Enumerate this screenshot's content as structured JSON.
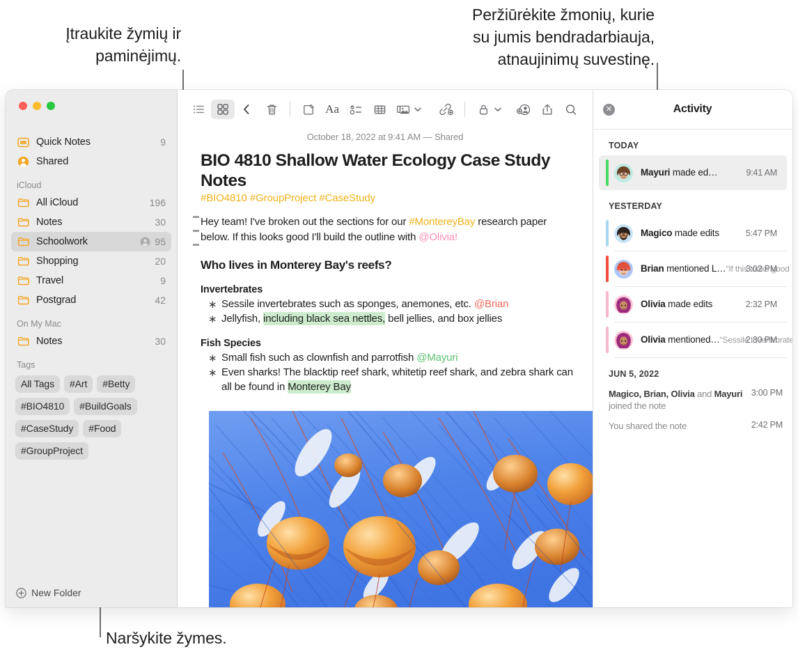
{
  "callouts": {
    "top_left": "Įtraukite žymių ir\npaminėjimų.",
    "top_right": "Peržiūrėkite žmonių, kurie\nsu jumis bendradarbiauja,\natnaujinimų suvestinę.",
    "bottom": "Naršykite žymes."
  },
  "sidebar": {
    "top_items": [
      {
        "label": "Quick Notes",
        "count": "9",
        "icon": "quicknote-icon"
      },
      {
        "label": "Shared",
        "count": "",
        "icon": "shared-person-icon"
      }
    ],
    "sections": [
      {
        "title": "iCloud",
        "items": [
          {
            "label": "All iCloud",
            "count": "196",
            "icon": "folder-icon",
            "selected": false,
            "shared": false
          },
          {
            "label": "Notes",
            "count": "30",
            "icon": "folder-icon",
            "selected": false,
            "shared": false
          },
          {
            "label": "Schoolwork",
            "count": "95",
            "icon": "folder-icon",
            "selected": true,
            "shared": true
          },
          {
            "label": "Shopping",
            "count": "20",
            "icon": "folder-icon",
            "selected": false,
            "shared": false
          },
          {
            "label": "Travel",
            "count": "9",
            "icon": "folder-icon",
            "selected": false,
            "shared": false
          },
          {
            "label": "Postgrad",
            "count": "42",
            "icon": "folder-icon",
            "selected": false,
            "shared": false
          }
        ]
      },
      {
        "title": "On My Mac",
        "items": [
          {
            "label": "Notes",
            "count": "30",
            "icon": "folder-icon",
            "selected": false,
            "shared": false
          }
        ]
      }
    ],
    "tags_title": "Tags",
    "tags": [
      "All Tags",
      "#Art",
      "#Betty",
      "#BIO4810",
      "#BuildGoals",
      "#CaseStudy",
      "#Food",
      "#GroupProject"
    ],
    "new_folder_label": "New Folder"
  },
  "toolbar": {
    "items": [
      {
        "name": "list-view-icon",
        "active": false
      },
      {
        "name": "gallery-view-icon",
        "active": true
      },
      {
        "name": "back-chevron-icon",
        "active": false
      },
      {
        "name": "trash-icon",
        "active": false
      },
      {
        "name": "compose-icon",
        "active": false
      },
      {
        "name": "format-aa-icon",
        "active": false
      },
      {
        "name": "checklist-icon",
        "active": false
      },
      {
        "name": "table-icon",
        "active": false
      },
      {
        "name": "media-icon",
        "active": false
      },
      {
        "name": "link-icon",
        "active": false
      },
      {
        "name": "lock-icon",
        "active": false
      },
      {
        "name": "add-people-icon",
        "active": false
      },
      {
        "name": "share-icon",
        "active": false
      },
      {
        "name": "search-icon",
        "active": false
      }
    ]
  },
  "note": {
    "date": "October 18, 2022 at 9:41 AM — Shared",
    "title": "BIO 4810 Shallow Water Ecology Case Study Notes",
    "tags_line": "#BIO4810 #GroupProject #CaseStudy",
    "intro": {
      "a": "Hey team! I've broken out the sections for our ",
      "tag": "#MontereyBay",
      "b": " research paper below. If this looks good I'll build the outline with ",
      "mention": "@Olivia!"
    },
    "heading": "Who lives in Monterey Bay's reefs?",
    "sections": [
      {
        "subhead": "Invertebrates",
        "bullets": [
          {
            "a": "Sessile invertebrates such as sponges, anemones, etc. ",
            "mention": "@Brian",
            "mention_color": "red",
            "b": ""
          },
          {
            "a": "Jellyfish, ",
            "highlight": "including black sea nettles,",
            "b": " bell jellies, and box jellies"
          }
        ]
      },
      {
        "subhead": "Fish Species",
        "bullets": [
          {
            "a": "Small fish such as clownfish and parrotfish ",
            "mention": "@Mayuri",
            "mention_color": "green",
            "b": ""
          },
          {
            "a": "Even sharks! The blacktip reef shark, whitetip reef shark, and zebra shark can all be found in ",
            "highlight": "Monterey Bay",
            "b": ""
          }
        ]
      }
    ],
    "image_alt": "jellyfish-photo"
  },
  "activity": {
    "title": "Activity",
    "close_label": "✕",
    "groups": [
      {
        "label": "TODAY",
        "entries": [
          {
            "actor": "Mayuri",
            "action": " made ed…",
            "quote": "",
            "time": "9:41 AM",
            "stripe": "#4cd964",
            "highlight": true,
            "avatar_bg": "#bfeae4",
            "hair": "#6d4428",
            "skin": "#e8b898",
            "accessory": "glasses"
          }
        ]
      },
      {
        "label": "YESTERDAY",
        "entries": [
          {
            "actor": "Magico",
            "action": " made edits",
            "quote": "",
            "time": "5:47 PM",
            "stripe": "#a8d8f0",
            "highlight": false,
            "avatar_bg": "#c8e6f7",
            "hair": "#2b2220",
            "skin": "#c98d63",
            "accessory": "glasses"
          },
          {
            "actor": "Brian",
            "action": " mentioned L…",
            "quote": "“If this looks good I'll…",
            "time": "3:02 PM",
            "stripe": "#f0503c",
            "highlight": false,
            "avatar_bg": "#aec6f5",
            "hair": "#b46a4a",
            "skin": "#efc6a8",
            "accessory": "beanie"
          },
          {
            "actor": "Olivia",
            "action": " made edits",
            "quote": "",
            "time": "2:32 PM",
            "stripe": "#f7b8cc",
            "highlight": false,
            "avatar_bg": "#f9c2d8",
            "hair": "#9c2b7a",
            "skin": "#c98d63",
            "accessory": "hijab"
          },
          {
            "actor": "Olivia",
            "action": " mentioned…",
            "quote": "“Sessile invertebrates…",
            "time": "2:30 PM",
            "stripe": "#f7b8cc",
            "highlight": false,
            "avatar_bg": "#f9c2d8",
            "hair": "#9c2b7a",
            "skin": "#c98d63",
            "accessory": "hijab"
          }
        ]
      }
    ],
    "older": {
      "label": "JUN 5, 2022",
      "rows": [
        {
          "bold_a": "Magico, Brian, Olivia",
          "mid": " and ",
          "bold_b": "Mayuri",
          "tail": " joined the note",
          "time": "3:00 PM"
        },
        {
          "bold_a": "",
          "mid": "You shared the note",
          "bold_b": "",
          "tail": "",
          "time": "2:42 PM"
        }
      ]
    }
  },
  "colors": {
    "tag_yellow": "#f0b21b",
    "mention_pink": "#fa8fb8",
    "mention_red": "#ef6a5a",
    "mention_green": "#5cc075",
    "highlight_green": "#cdeccd",
    "sidebar_bg": "#ececec",
    "folder_orange": "#f5a623"
  }
}
